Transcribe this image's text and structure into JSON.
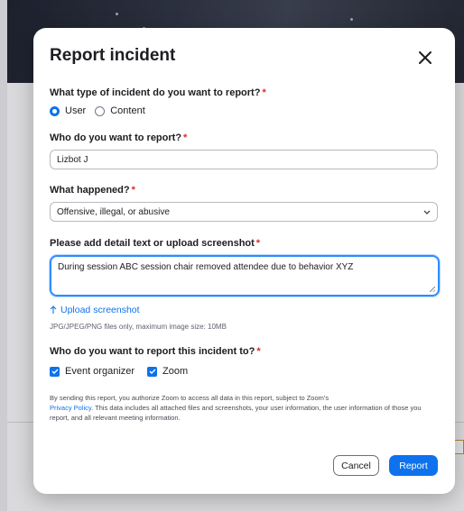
{
  "modal": {
    "title": "Report incident"
  },
  "incident_type": {
    "label": "What type of incident do you want to report?",
    "required_mark": "*",
    "options": [
      "User",
      "Content"
    ],
    "selected": "User"
  },
  "who": {
    "label": "Who do you want to report?",
    "required_mark": "*",
    "value": "Lizbot J"
  },
  "what_happened": {
    "label": "What happened?",
    "required_mark": "*",
    "value": "Offensive, illegal, or abusive"
  },
  "detail": {
    "label": "Please add detail text or upload screenshot",
    "required_mark": "*",
    "value": "During session ABC session chair removed attendee due to behavior XYZ",
    "upload_label": "Upload screenshot",
    "upload_hint": "JPG/JPEG/PNG files only, maximum image size: 10MB"
  },
  "report_to": {
    "label": "Who do you want to report this incident to?",
    "required_mark": "*",
    "options": [
      {
        "label": "Event organizer",
        "checked": true
      },
      {
        "label": "Zoom",
        "checked": true
      }
    ]
  },
  "disclaimer": {
    "before_link": "By sending this report, you authorize Zoom to access all data in this report, subject to Zoom's",
    "link": "Privacy Policy",
    "after_link": ". This data includes all attached files and screenshots, your user information, the user information of those you report, and all relevant meeting information."
  },
  "buttons": {
    "cancel": "Cancel",
    "report": "Report"
  },
  "colors": {
    "accent": "#0e72ed",
    "required": "#e02828"
  }
}
